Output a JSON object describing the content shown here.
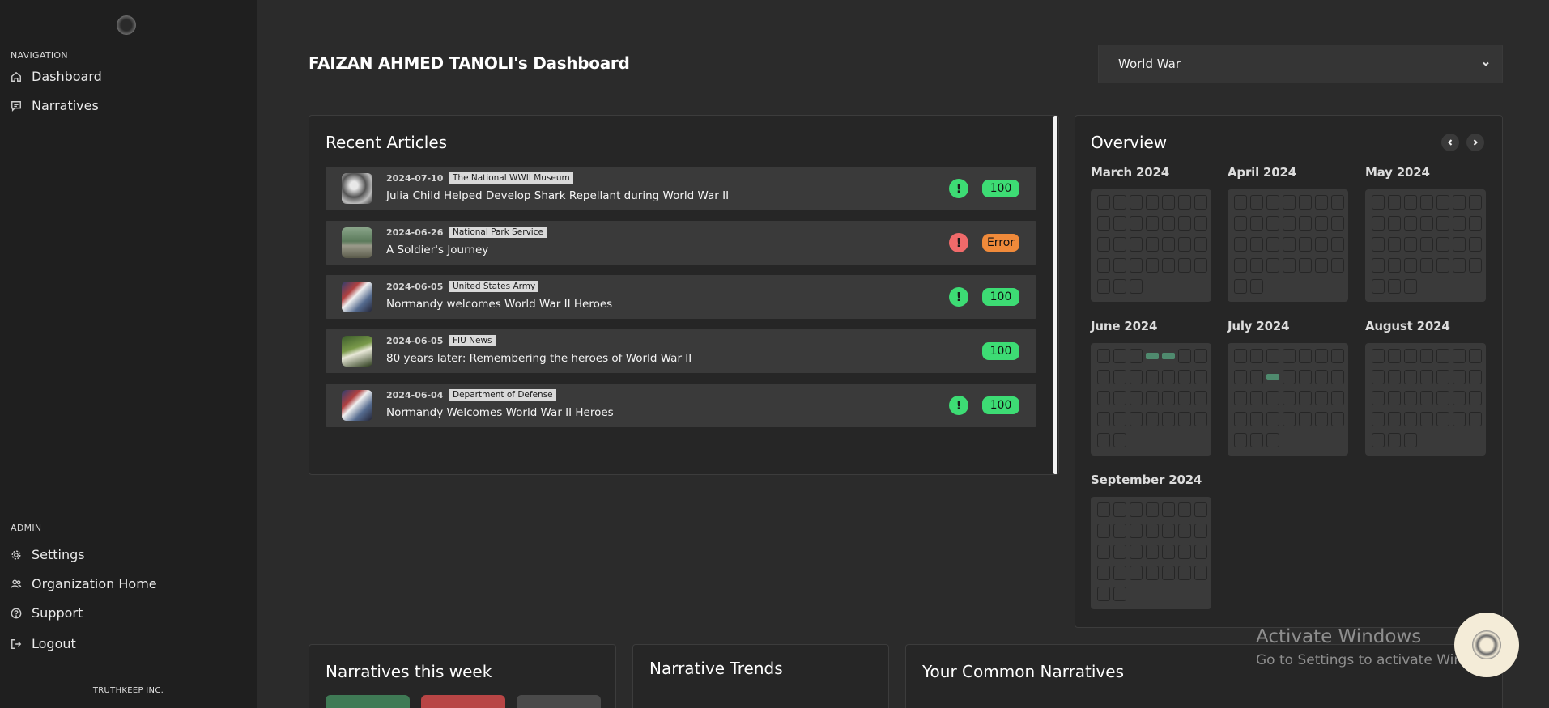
{
  "sidebar": {
    "nav_label": "NAVIGATION",
    "nav_items": [
      {
        "label": "Dashboard",
        "icon": "home-icon"
      },
      {
        "label": "Narratives",
        "icon": "message-square-icon"
      }
    ],
    "admin_label": "ADMIN",
    "admin_items": [
      {
        "label": "Settings",
        "icon": "gear-icon"
      },
      {
        "label": "Organization Home",
        "icon": "users-icon"
      },
      {
        "label": "Support",
        "icon": "help-circle-icon"
      },
      {
        "label": "Logout",
        "icon": "logout-icon"
      }
    ],
    "company": "TRUTHKEEP INC."
  },
  "header": {
    "title": "FAIZAN AHMED TANOLI's Dashboard",
    "topic_selected": "World War"
  },
  "recent_articles": {
    "title": "Recent Articles",
    "items": [
      {
        "date": "2024-07-10",
        "source": "The National WWII Museum",
        "title": "Julia Child Helped Develop Shark Repellant during World War II",
        "status": "ok",
        "score": "100"
      },
      {
        "date": "2024-06-26",
        "source": "National Park Service",
        "title": "A Soldier's Journey",
        "status": "error",
        "score": "Error"
      },
      {
        "date": "2024-06-05",
        "source": "United States Army",
        "title": "Normandy welcomes World War II Heroes",
        "status": "ok",
        "score": "100"
      },
      {
        "date": "2024-06-05",
        "source": "FIU News",
        "title": "80 years later: Remembering the heroes of World War II",
        "status": "none",
        "score": "100"
      },
      {
        "date": "2024-06-04",
        "source": "Department of Defense",
        "title": "Normandy Welcomes World War II Heroes",
        "status": "ok",
        "score": "100"
      }
    ]
  },
  "overview": {
    "title": "Overview",
    "months": [
      {
        "label": "March 2024",
        "days": 31,
        "active": []
      },
      {
        "label": "April 2024",
        "days": 30,
        "active": []
      },
      {
        "label": "May 2024",
        "days": 31,
        "active": []
      },
      {
        "label": "June 2024",
        "days": 30,
        "active": [
          4,
          5
        ]
      },
      {
        "label": "July 2024",
        "days": 31,
        "active": [
          10
        ]
      },
      {
        "label": "August 2024",
        "days": 31,
        "active": []
      },
      {
        "label": "September 2024",
        "days": 30,
        "active": []
      }
    ]
  },
  "bottom": {
    "narratives_week": "Narratives this week",
    "narrative_trends": "Narrative Trends",
    "common_narratives": "Your Common Narratives"
  },
  "colors": {
    "ok": "#3ddc74",
    "error_icon": "#f06a6a",
    "error_badge": "#f08a3a",
    "active_day": "#4f8a6e"
  },
  "watermark": {
    "line1": "Activate Windows",
    "line2": "Go to Settings to activate Windows."
  }
}
